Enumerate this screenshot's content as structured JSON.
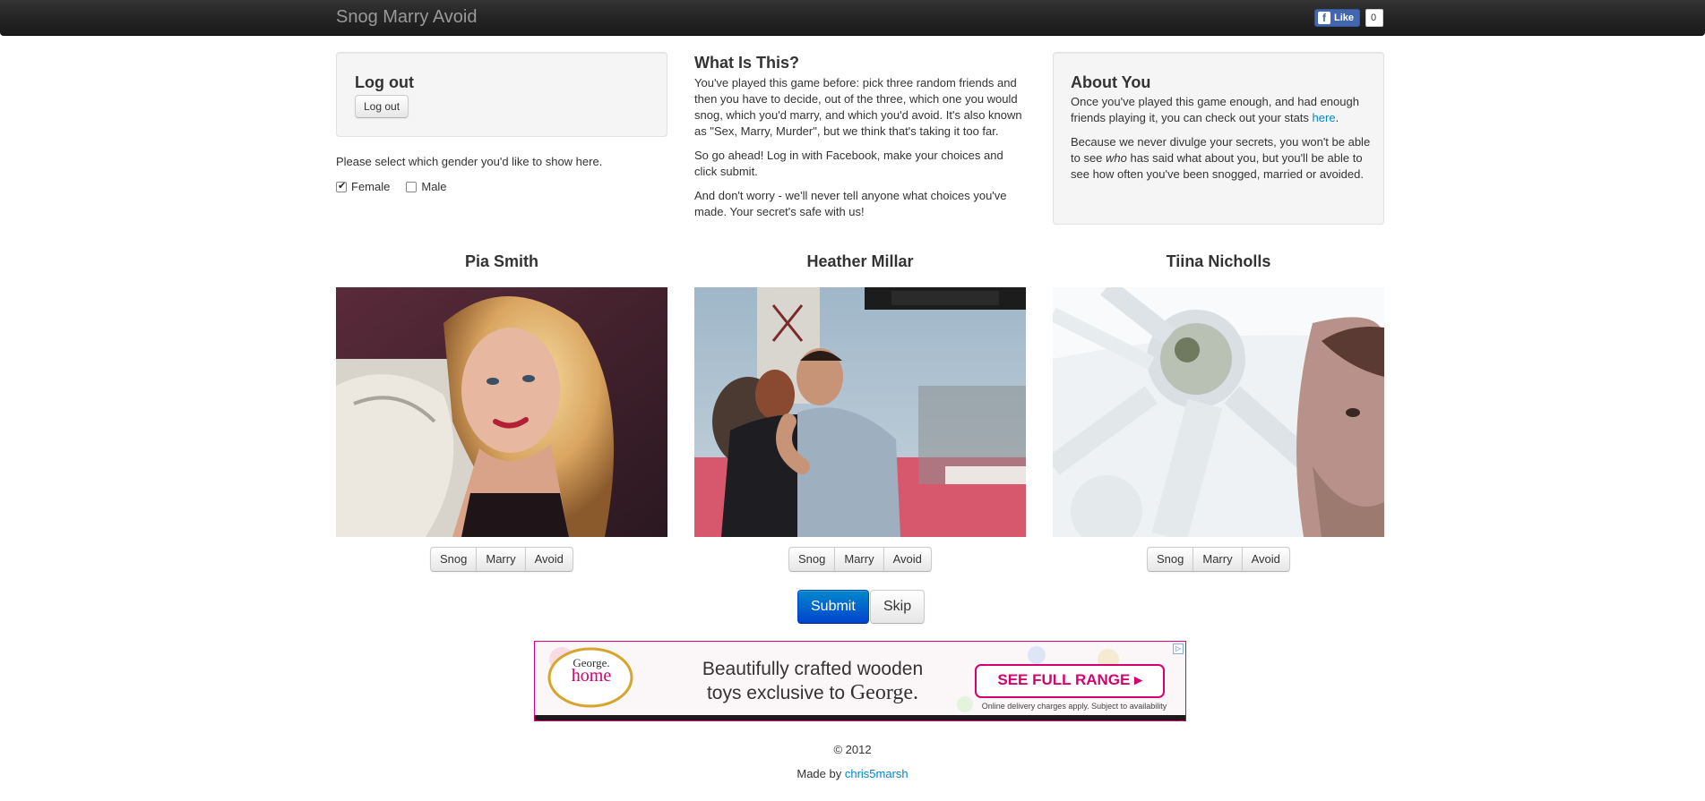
{
  "navbar": {
    "brand": "Snog Marry Avoid",
    "fb_like_label": "Like",
    "fb_like_count": "0"
  },
  "login_box": {
    "title": "Log out",
    "button": "Log out"
  },
  "gender": {
    "prompt": "Please select which gender you'd like to show here.",
    "options": [
      {
        "label": "Female",
        "checked": true
      },
      {
        "label": "Male",
        "checked": false
      }
    ]
  },
  "what_is_this": {
    "title": "What Is This?",
    "p1": "You've played this game before: pick three random friends and then you have to decide, out of the three, which one you would snog, which you'd marry, and which you'd avoid. It's also known as \"Sex, Marry, Murder\", but we think that's taking it too far.",
    "p2": "So go ahead! Log in with Facebook, make your choices and click submit.",
    "p3": "And don't worry - we'll never tell anyone what choices you've made. Your secret's safe with us!"
  },
  "about_you": {
    "title": "About You",
    "p1_before": "Once you've played this game enough, and had enough friends playing it, you can check out your stats ",
    "p1_link": "here",
    "p1_after": ".",
    "p2_before": "Because we never divulge your secrets, you won't be able to see ",
    "p2_em": "who",
    "p2_after": " has said what about you, but you'll be able to see how often you've been snogged, married or avoided."
  },
  "friends": [
    {
      "name": "Pia Smith"
    },
    {
      "name": "Heather Millar"
    },
    {
      "name": "Tiina Nicholls"
    }
  ],
  "choice_buttons": {
    "snog": "Snog",
    "marry": "Marry",
    "avoid": "Avoid"
  },
  "actions": {
    "submit": "Submit",
    "skip": "Skip"
  },
  "ad": {
    "logo_top": "George.",
    "logo_bottom": "home",
    "headline_line1": "Beautifully crafted wooden",
    "headline_line2_prefix": "toys exclusive to ",
    "headline_line2_brand": "George.",
    "cta": "SEE FULL RANGE ▸",
    "disclaimer": "Online delivery charges apply. Subject to availability"
  },
  "footer": {
    "copyright": "© 2012",
    "made_by_prefix": "Made by ",
    "made_by_link": "chris5marsh"
  },
  "colors": {
    "link": "#0088cc",
    "primary": "#0070d0",
    "ad_border": "#e0007a",
    "cta_pink": "#d6006f"
  }
}
